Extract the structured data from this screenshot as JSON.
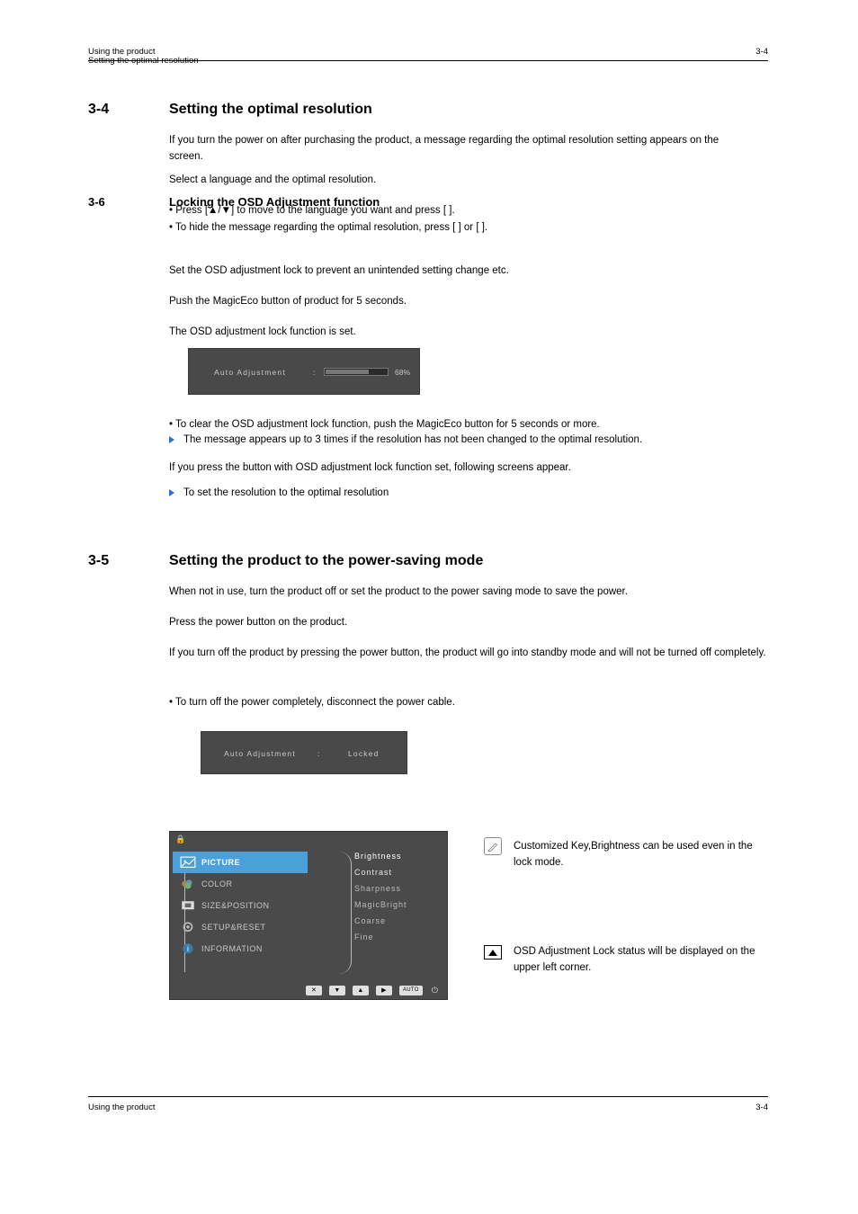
{
  "header": {
    "left_line1": "Using the product",
    "left_line2": "Setting the optimal resolution",
    "right": "3-4"
  },
  "footer": {
    "left": "Using the product",
    "right": "3-4"
  },
  "s1": {
    "num": "3-4",
    "title": "Setting the optimal resolution",
    "p1": "If you turn the power on after purchasing the product, a message regarding the optimal resolution setting appears on the screen.",
    "p2": "Select a language and the optimal resolution.",
    "bullet1": "Press [▲/▼] to move to the language you want and press [ ].",
    "bullet2": "To hide the message regarding the optimal resolution, press [ ] or [ ].",
    "tri1": "The message appears up to 3 times if the resolution has not been changed to the optimal resolution.",
    "tri2": "To set the resolution to the optimal resolution"
  },
  "s2": {
    "num": "3-5",
    "title": "Setting the product to the power-saving mode",
    "p1": "When not in use, turn the product off or set the product to the power saving mode to save the power.",
    "p2": "Press the power button on the product.",
    "p3": "If you turn off the product by pressing the power button, the product will go into standby mode and will not be turned off completely.",
    "p4": "To turn off the power completely, disconnect the power cable."
  },
  "s3": {
    "num": "3-6",
    "title": "Locking the OSD Adjustment function",
    "p1": "Set the OSD adjustment lock to prevent an unintended setting change etc.",
    "p2": "Push the MagicEco button of product for 5 seconds.",
    "p3": "The OSD adjustment lock function is set.",
    "bullet1": "To clear the OSD adjustment lock function, push the MagicEco button for 5 seconds or more.",
    "p4": "If you press the button with OSD adjustment lock function set, following screens appear.",
    "note_text": "Customized Key,Brightness can be used even in the lock mode.",
    "tip_text": "OSD Adjustment Lock status will be displayed on the upper left corner."
  },
  "osd1": {
    "label": "Auto Adjustment",
    "value": "68",
    "pct": "%"
  },
  "osd2": {
    "label": "Auto Adjustment",
    "status": "Locked"
  },
  "osd3": {
    "menu": {
      "picture": "PICTURE",
      "color": "COLOR",
      "sizepos": "SIZE&POSITION",
      "setup": "SETUP&RESET",
      "info": "INFORMATION"
    },
    "right": {
      "brightness": "Brightness",
      "contrast": "Contrast",
      "sharpness": "Sharpness",
      "magicbright": "MagicBright",
      "coarse": "Coarse",
      "fine": "Fine"
    },
    "auto": "AUTO"
  }
}
